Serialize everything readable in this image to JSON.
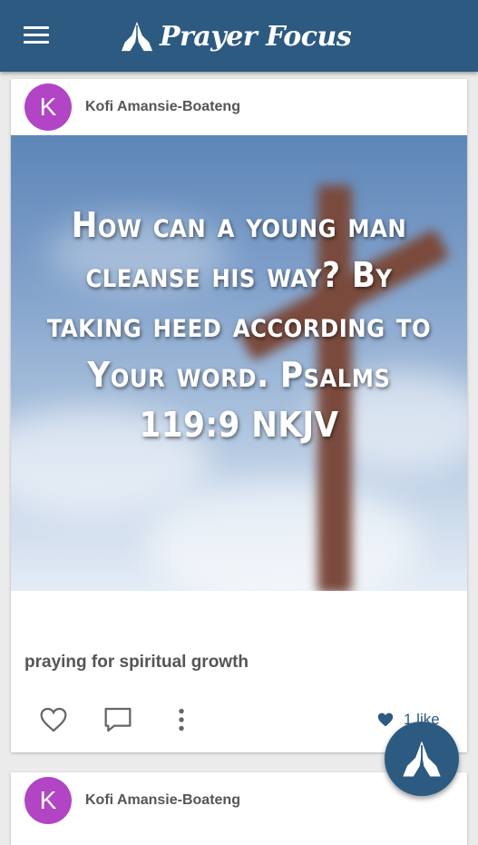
{
  "appbar": {
    "title": "Prayer Focus",
    "menu_icon": "hamburger-menu-icon",
    "logo_icon": "praying-hands-icon",
    "background": "#2d5a80"
  },
  "posts": [
    {
      "avatar_letter": "K",
      "avatar_color": "#b145c4",
      "author": "Kofi Amansie-Boateng",
      "image_text": "How can a young man cleanse his way? By taking heed according to Your word. Psalms 119:9 NKJV",
      "caption": "praying for spiritual growth",
      "likes_text": "1 like",
      "actions": [
        "heart-outline-icon",
        "comment-icon",
        "more-vertical-icon"
      ]
    },
    {
      "avatar_letter": "K",
      "avatar_color": "#b145c4",
      "author": "Kofi Amansie-Boateng"
    }
  ],
  "fab": {
    "icon": "praying-hands-icon"
  }
}
